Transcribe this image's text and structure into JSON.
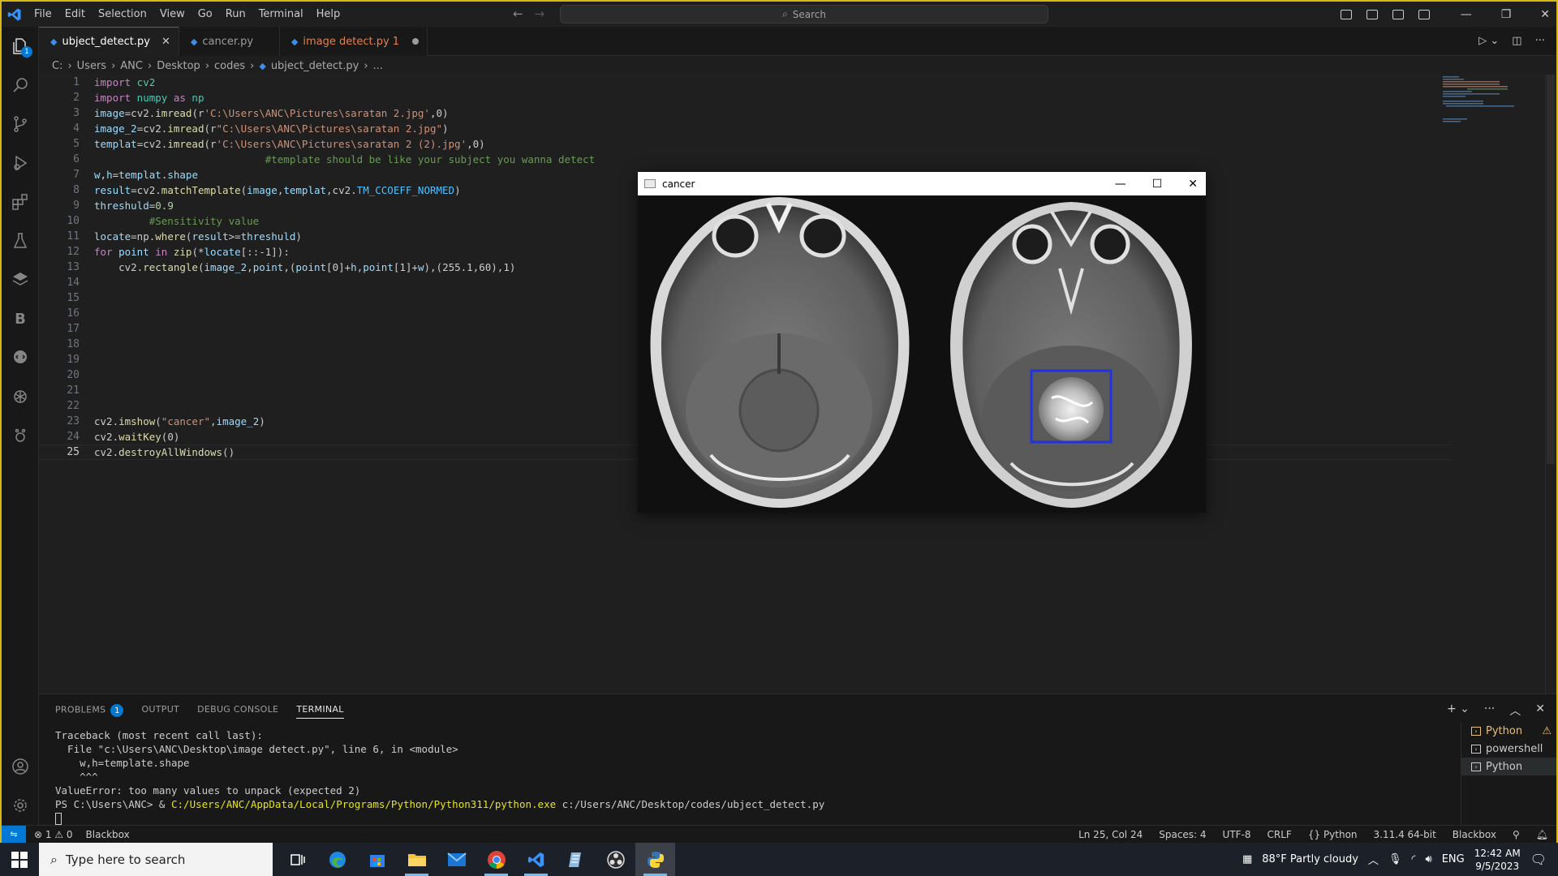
{
  "menu": [
    "File",
    "Edit",
    "Selection",
    "View",
    "Go",
    "Run",
    "Terminal",
    "Help"
  ],
  "search": {
    "label": "Search"
  },
  "activity_badge": "1",
  "tabs": [
    {
      "label": "ubject_detect.py",
      "state": "active"
    },
    {
      "label": "cancer.py",
      "state": "normal"
    },
    {
      "label": "image detect.py 1",
      "state": "modified"
    }
  ],
  "breadcrumb": [
    "C:",
    "Users",
    "ANC",
    "Desktop",
    "codes",
    "ubject_detect.py",
    "..."
  ],
  "line_numbers": [
    "1",
    "2",
    "3",
    "4",
    "5",
    "6",
    "7",
    "8",
    "9",
    "10",
    "11",
    "12",
    "13",
    "14",
    "15",
    "16",
    "17",
    "18",
    "19",
    "20",
    "21",
    "22",
    "23",
    "24",
    "25"
  ],
  "current_line": "25",
  "code": {
    "l1a": "import",
    "l1b": " cv2",
    "l2a": "import",
    "l2b": " numpy ",
    "l2c": "as",
    "l2d": " np",
    "l3a": "image",
    "l3b": "=cv2.",
    "l3c": "imread",
    "l3d": "(r",
    "l3e": "'C:\\Users\\ANC\\Pictures\\saratan 2.jpg'",
    "l3f": ",0)",
    "l4a": "image_2",
    "l4b": "=cv2.",
    "l4c": "imread",
    "l4d": "(r",
    "l4e": "\"C:\\Users\\ANC\\Pictures\\saratan 2.jpg\"",
    "l4f": ")",
    "l5a": "templat",
    "l5b": "=cv2.",
    "l5c": "imread",
    "l5d": "(r",
    "l5e": "'C:\\Users\\ANC\\Pictures\\saratan 2 (2).jpg'",
    "l5f": ",0)",
    "l6": "#template should be like your subject you wanna detect",
    "l7a": "w",
    "l7b": ",",
    "l7c": "h",
    "l7d": "=",
    "l7e": "templat",
    ".": ".",
    "l7f": "shape",
    "l8a": "result",
    "l8b": "=cv2.",
    "l8c": "matchTemplate",
    "l8d": "(",
    "l8e": "image",
    "l8f": ",",
    "l8g": "templat",
    "l8h": ",cv2.",
    "l8i": "TM_CCOEFF_NORMED",
    "l8j": ")",
    "l9a": "threshuld",
    "l9b": "=",
    "l9c": "0.9",
    "l10": "#Sensitivity value",
    "l11a": "locate",
    "l11b": "=np.",
    "l11c": "where",
    "l11d": "(",
    "l11e": "result",
    ">=": ">=",
    "l11f": "threshuld",
    "l11g": ")",
    "l12a": "for",
    "l12b": " point ",
    "l12c": "in",
    "l12d": " zip",
    "l12e": "(*",
    "l12f": "locate",
    "l12g": "[::-1]):",
    "l13a": "cv2.",
    "l13b": "rectangle",
    "l13c": "(",
    "l13d": "image_2",
    "l13e": ",",
    "l13f": "point",
    "l13g": ",(",
    "l13h": "point",
    "l13i": "[0]+",
    "l13j": "h",
    "l13k": ",",
    "l13l": "point",
    "l13m": "[1]+",
    "l13n": "w",
    "l13o": "),(255.1,60),1)",
    "l23a": "cv2.",
    "l23b": "imshow",
    "l23c": "(",
    "l23d": "\"cancer\"",
    "l23e": ",",
    "l23f": "image_2",
    "l23g": ")",
    "l24a": "cv2.",
    "l24b": "waitKey",
    "l24c": "(0)",
    "l25a": "cv2.",
    "l25b": "destroyAllWindows",
    "l25c": "()"
  },
  "panel": {
    "tabs": [
      "PROBLEMS",
      "OUTPUT",
      "DEBUG CONSOLE",
      "TERMINAL"
    ],
    "problems_count": "1",
    "terminal_lines": [
      "Traceback (most recent call last):",
      "  File \"c:\\Users\\ANC\\Desktop\\image detect.py\", line 6, in <module>",
      "    w,h=template.shape",
      "    ^^^",
      "ValueError: too many values to unpack (expected 2)"
    ],
    "prompt": "PS C:\\Users\\ANC> & ",
    "python_path": "C:/Users/ANC/AppData/Local/Programs/Python/Python311/python.exe",
    "script_path": " c:/Users/ANC/Desktop/codes/ubject_detect.py",
    "terminals": [
      "Python",
      "powershell",
      "Python"
    ]
  },
  "status": {
    "errors": "1",
    "warnings": "0",
    "blackbox_left": "Blackbox",
    "position": "Ln 25, Col 24",
    "spaces": "Spaces: 4",
    "encoding": "UTF-8",
    "eol": "CRLF",
    "language": "Python",
    "interpreter": "3.11.4 64-bit",
    "blackbox_right": "Blackbox"
  },
  "cancer_window": {
    "title": "cancer"
  },
  "taskbar": {
    "search_placeholder": "Type here to search",
    "weather": "88°F  Partly cloudy",
    "lang": "ENG",
    "time": "12:42 AM",
    "date": "9/5/2023"
  },
  "colors": {
    "accent": "#0078d4",
    "frame": "#d6b917",
    "detect_box": "#2233dd"
  }
}
